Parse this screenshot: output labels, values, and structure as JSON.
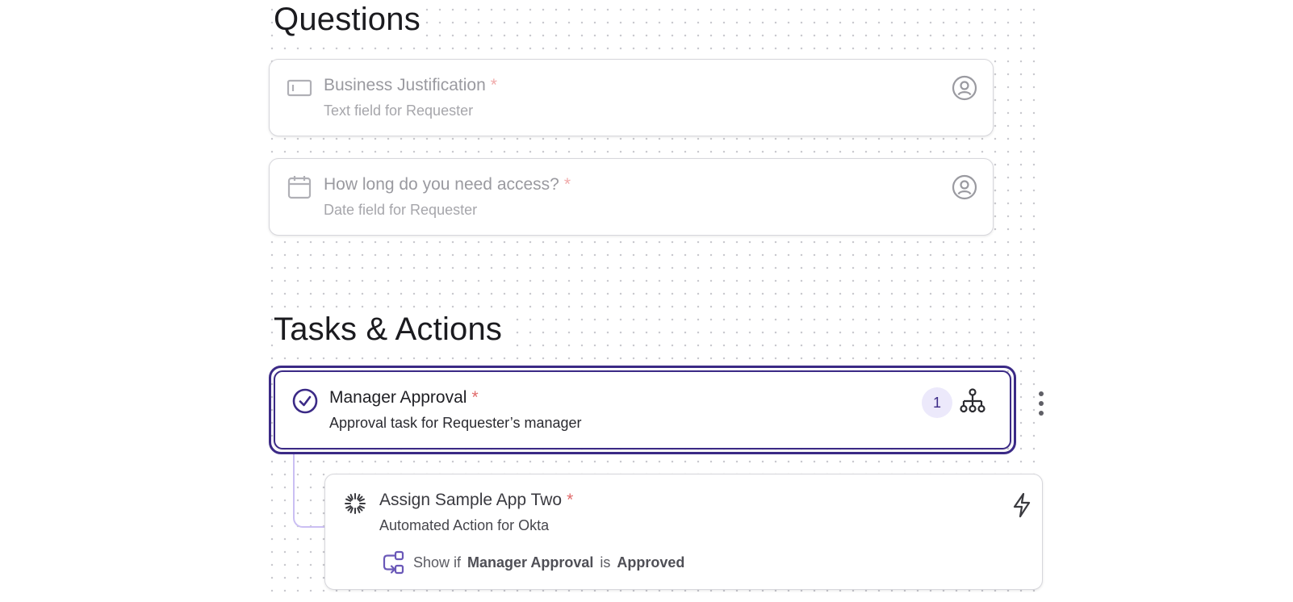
{
  "questions": {
    "heading": "Questions",
    "items": [
      {
        "title": "Business Justification",
        "required_mark": "*",
        "subtitle": "Text field for Requester",
        "icon": "text-field-icon",
        "right_icon": "user-circle-icon"
      },
      {
        "title": "How long do you need access?",
        "required_mark": "*",
        "subtitle": "Date field for Requester",
        "icon": "calendar-icon",
        "right_icon": "user-circle-icon"
      }
    ]
  },
  "tasks": {
    "heading": "Tasks & Actions",
    "manager_approval": {
      "title": "Manager Approval",
      "required_mark": "*",
      "subtitle": "Approval task for Requester’s manager",
      "badge_count": "1",
      "icon": "check-circle-icon",
      "right_icon": "org-chart-icon"
    },
    "assign_action": {
      "title": "Assign Sample App Two",
      "required_mark": "*",
      "subtitle": "Automated Action for Okta",
      "icon": "okta-sunburst-icon",
      "right_icon": "lightning-icon",
      "condition": {
        "prefix": "Show if",
        "task": "Manager Approval",
        "operator": "is",
        "value": "Approved"
      }
    }
  },
  "colors": {
    "accent": "#3b2a86",
    "badge_bg": "#ece9fb",
    "required": "#e06a6a",
    "connector": "#cbbff3"
  }
}
